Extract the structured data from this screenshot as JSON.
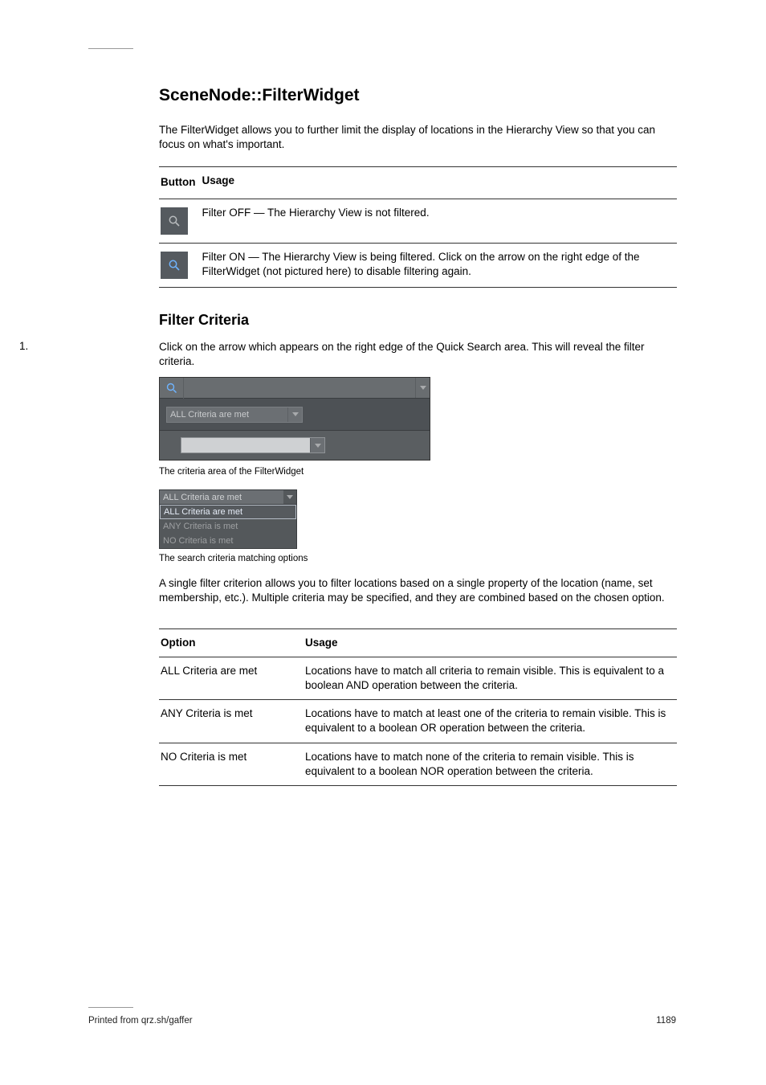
{
  "page": {
    "number": "1189",
    "footer": "Printed from qrz.sh/gaffer"
  },
  "heading": "SceneNode::FilterWidget",
  "intro": "The FilterWidget allows you to further limit the display of locations in the Hierarchy View so that you can focus on what's important.",
  "mode_table": {
    "col1": "Button",
    "col2": "Usage",
    "rows": [
      {
        "icon": "search-icon",
        "text": "Filter OFF — The Hierarchy View is not filtered."
      },
      {
        "icon": "search-icon",
        "text": "Filter ON — The Hierarchy View is being filtered. Click on the arrow on the right edge of the FilterWidget (not pictured here) to disable filtering again."
      }
    ]
  },
  "section_filter_criteria": "Filter Criteria",
  "panel_caption": "The criteria area of the FilterWidget",
  "panel_combo_label": "ALL Criteria are met",
  "dropdown_caption": "The search criteria matching options",
  "dropdown": {
    "head": "ALL Criteria are met",
    "items": [
      {
        "label": "ALL Criteria are met",
        "selected": true
      },
      {
        "label": "ANY Criteria is met",
        "selected": false
      },
      {
        "label": "NO Criteria is met",
        "selected": false
      }
    ]
  },
  "para_under_dropdown": "A single filter criterion allows you to filter locations based on a single property of the location (name, set membership, etc.). Multiple criteria may be specified, and they are combined based on the chosen option.",
  "criteria_table": {
    "col1": "Option",
    "col2": "Usage",
    "rows": [
      {
        "opt": "ALL Criteria are met",
        "desc": "Locations have to match all criteria to remain visible. This is equivalent to a boolean AND operation between the criteria."
      },
      {
        "opt": "ANY Criteria is met",
        "desc": "Locations have to match at least one of the criteria to remain visible. This is equivalent to a boolean OR operation between the criteria."
      },
      {
        "opt": "NO Criteria is met",
        "desc": "Locations have to match none of the criteria to remain visible. This is equivalent to a boolean NOR operation between the criteria."
      }
    ]
  },
  "step_num": "1.",
  "step_text": "Click on the arrow which appears on the right edge of the Quick Search area. This will reveal the filter criteria."
}
